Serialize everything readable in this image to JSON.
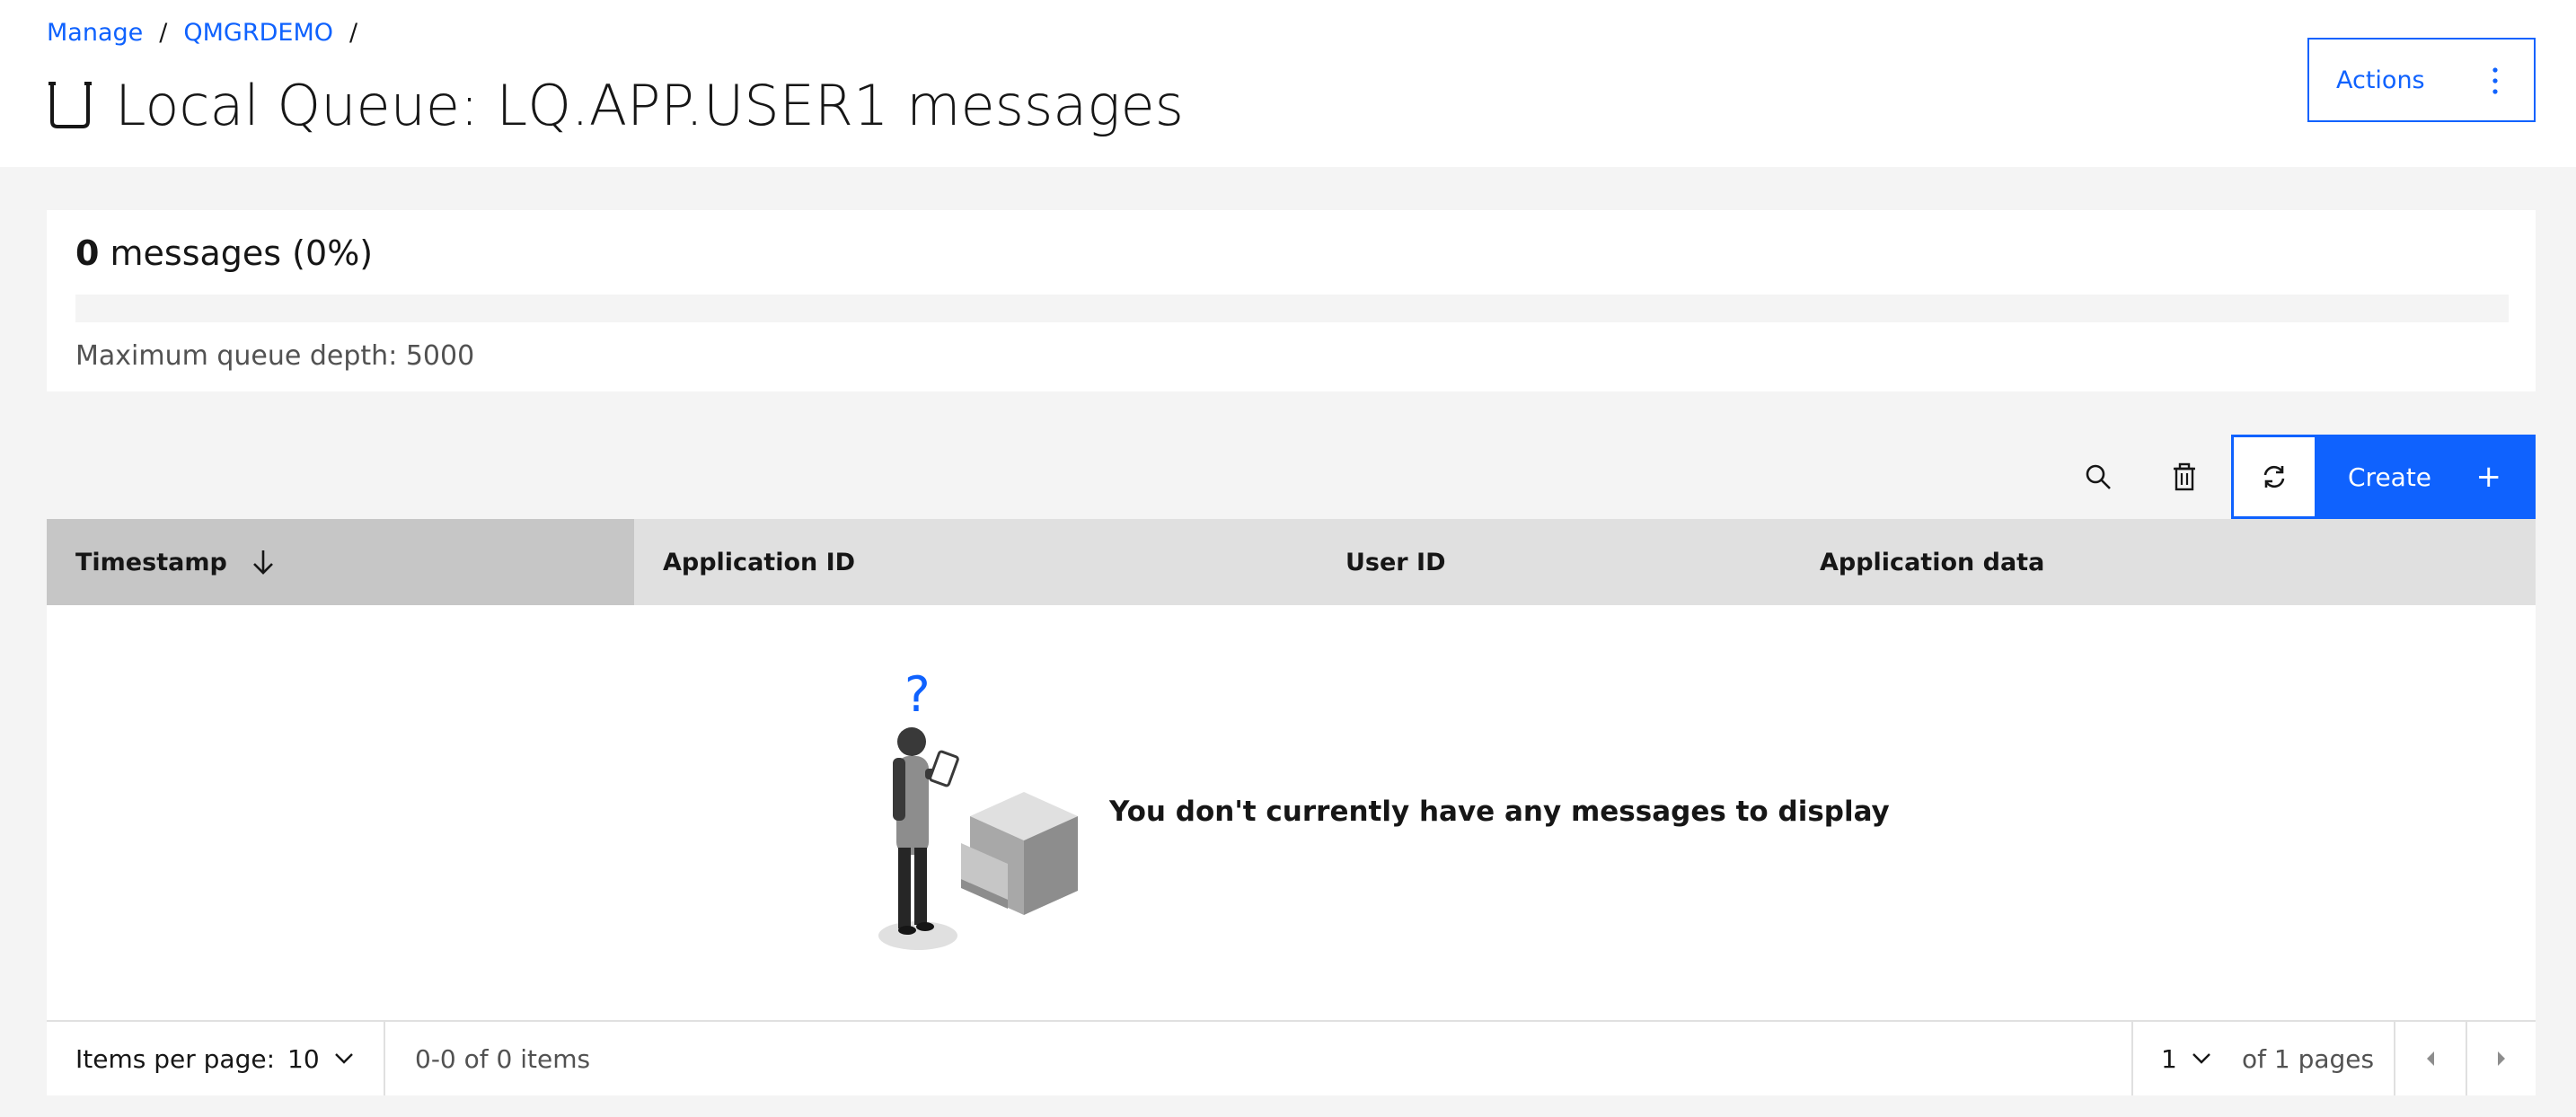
{
  "breadcrumb": {
    "items": [
      {
        "label": "Manage"
      },
      {
        "label": "QMGRDEMO"
      }
    ],
    "separator": "/"
  },
  "header": {
    "title": "Local Queue: LQ.APP.USER1 messages",
    "title_icon": "queue-icon",
    "actions_label": "Actions",
    "actions_icon": "overflow-menu-vertical-icon"
  },
  "depth": {
    "count": "0",
    "label": " messages (0%)",
    "percent": 0,
    "max_label": "Maximum queue depth: 5000"
  },
  "toolbar": {
    "search_icon": "search-icon",
    "delete_icon": "trash-icon",
    "refresh_icon": "refresh-icon",
    "create_label": "Create",
    "create_icon": "plus-icon",
    "create_glyph": "+"
  },
  "table": {
    "columns": [
      {
        "label": "Timestamp",
        "sorted": "descending"
      },
      {
        "label": "Application ID"
      },
      {
        "label": "User ID"
      },
      {
        "label": "Application data"
      }
    ],
    "rows": [],
    "empty_message": "You don't currently have any messages to display",
    "empty_glyph": "?"
  },
  "pagination": {
    "items_per_page_label": "Items per page:",
    "items_per_page": "10",
    "range_text": "0-0 of 0 items",
    "current_page": "1",
    "of_pages_text": "of 1 pages"
  },
  "colors": {
    "accent": "#0f62fe",
    "header_bg": "#ffffff",
    "page_bg": "#f4f4f4",
    "table_header_bg": "#e0e0e0",
    "sorted_header_bg": "#c6c6c6"
  }
}
